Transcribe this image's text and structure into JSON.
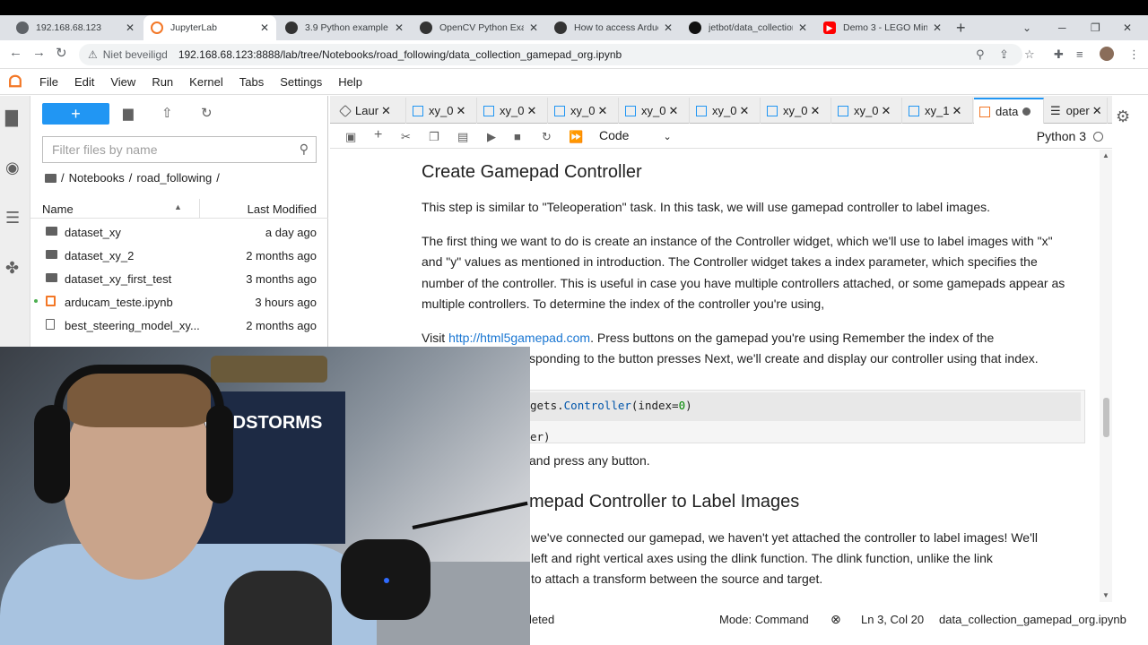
{
  "browser": {
    "tabs": [
      {
        "title": "192.168.68.123",
        "active": false
      },
      {
        "title": "JupyterLab",
        "active": true
      },
      {
        "title": "3.9 Python example -",
        "active": false
      },
      {
        "title": "OpenCV Python Exam",
        "active": false
      },
      {
        "title": "How to access Arducam",
        "active": false
      },
      {
        "title": "jetbot/data_collection",
        "active": false
      },
      {
        "title": "Demo 3 - LEGO Mind",
        "active": false
      }
    ],
    "close_glyph": "✕",
    "new_tab": "+",
    "security_label": "Niet beveiligd",
    "url": "192.168.68.123:8888/lab/tree/Notebooks/road_following/data_collection_gamepad_org.ipynb"
  },
  "menu": [
    "File",
    "Edit",
    "View",
    "Run",
    "Kernel",
    "Tabs",
    "Settings",
    "Help"
  ],
  "filebrowser": {
    "new_label": "+",
    "filter_placeholder": "Filter files by name",
    "breadcrumb": [
      "/",
      "Notebooks",
      "/",
      "road_following",
      "/"
    ],
    "col_name": "Name",
    "col_modified": "Last Modified",
    "files": [
      {
        "name": "dataset_xy",
        "modified": "a day ago",
        "type": "folder"
      },
      {
        "name": "dataset_xy_2",
        "modified": "2 months ago",
        "type": "folder"
      },
      {
        "name": "dataset_xy_first_test",
        "modified": "3 months ago",
        "type": "folder"
      },
      {
        "name": "arducam_teste.ipynb",
        "modified": "3 hours ago",
        "type": "notebook"
      },
      {
        "name": "best_steering_model_xy...",
        "modified": "2 months ago",
        "type": "file"
      }
    ]
  },
  "doctabs": [
    {
      "label": "Laur"
    },
    {
      "label": "xy_0"
    },
    {
      "label": "xy_0"
    },
    {
      "label": "xy_0"
    },
    {
      "label": "xy_0"
    },
    {
      "label": "xy_0"
    },
    {
      "label": "xy_0"
    },
    {
      "label": "xy_0"
    },
    {
      "label": "xy_1"
    },
    {
      "label": "data"
    },
    {
      "label": "oper"
    }
  ],
  "toolbar": {
    "cell_type": "Code",
    "kernel": "Python 3"
  },
  "notebook": {
    "heading1": "Create Gamepad Controller",
    "para1": "This step is similar to \"Teleoperation\" task. In this task, we will use gamepad controller to label images.",
    "para2": "The first thing we want to do is create an instance of the Controller widget, which we'll use to label images with \"x\" and \"y\" values as mentioned in introduction. The Controller widget takes a index parameter, which specifies the number of the controller. This is useful in case you have multiple controllers attached, or some gamepads appear as multiple controllers. To determine the index of the controller you're using,",
    "para3_pre": "Visit ",
    "para3_link": "http://html5gamepad.com",
    "para3_post": ". Press buttons on the gamepad you're using Remember the index of the",
    "para3_line2": "sponding to the button presses Next, we'll create and display our controller using that index.",
    "code_line1_a": "gets.",
    "code_line1_b": "Controller",
    "code_line1_c": "(index=",
    "code_line1_d": "0",
    "code_line1_e": ")",
    "code_line2": "er)",
    "para4": "and press any button.",
    "heading2": "mepad Controller to Label Images",
    "para5_l1": "we've connected our gamepad, we haven't yet attached the controller to label images! We'll",
    "para5_l2": "left and right vertical axes using the dlink function. The dlink function, unlike the link",
    "para5_l3": "to attach a transform between the source and target."
  },
  "status": {
    "left": "leted",
    "mode": "Mode: Command",
    "position": "Ln 3, Col 20",
    "filename": "data_collection_gamepad_org.ipynb"
  },
  "webcam": {
    "box_text": "MINDSTORMS"
  }
}
